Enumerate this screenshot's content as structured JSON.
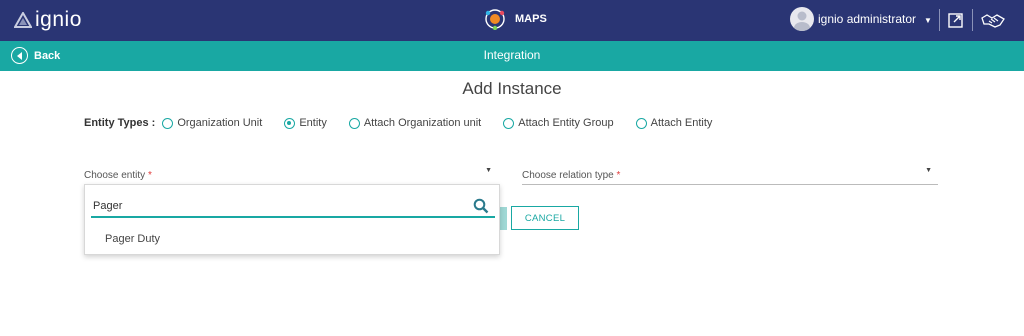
{
  "header": {
    "logo_text": "ignio",
    "app_label": "MAPS",
    "user_name": "ignio administrator",
    "colors": {
      "bar": "#2a3574",
      "accent": "#19a8a3"
    }
  },
  "subheader": {
    "back_label": "Back",
    "title": "Integration"
  },
  "page": {
    "title": "Add Instance",
    "entity_types_label": "Entity Types :",
    "entity_types": [
      {
        "label": "Organization Unit",
        "selected": false
      },
      {
        "label": "Entity",
        "selected": true
      },
      {
        "label": "Attach Organization unit",
        "selected": false
      },
      {
        "label": "Attach Entity Group",
        "selected": false
      },
      {
        "label": "Attach Entity",
        "selected": false
      }
    ],
    "choose_entity": {
      "label": "Choose entity",
      "required_mark": "*"
    },
    "choose_relation": {
      "label": "Choose relation type",
      "required_mark": "*"
    },
    "cancel_label": "CANCEL"
  },
  "dropdown": {
    "search_value": "Pager",
    "options": [
      "Pager Duty"
    ]
  },
  "icons": {
    "logo": "ignio-logo-icon",
    "maps": "maps-icon",
    "avatar": "user-avatar-icon",
    "caret": "chevron-down-icon",
    "toolbar_1": "export-icon",
    "toolbar_2": "handshake-icon",
    "back": "arrow-left-circle-icon",
    "search": "search-icon"
  }
}
